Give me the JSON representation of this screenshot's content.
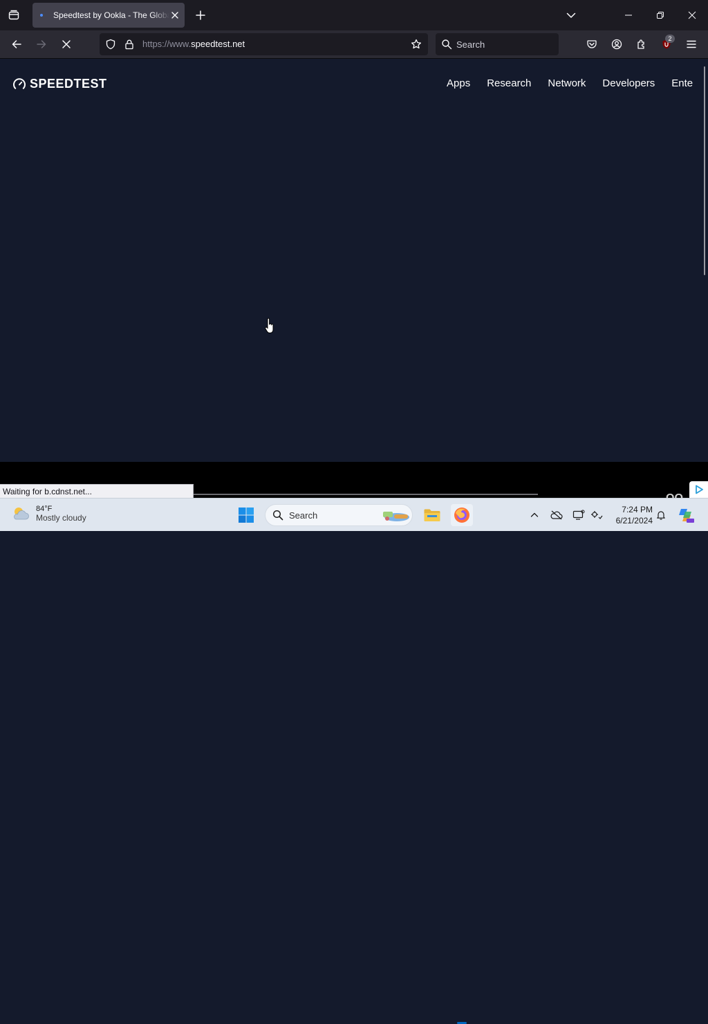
{
  "browser": {
    "active_tab_title": "Speedtest by Ookla - The Global Broadband Speed Test",
    "url_scheme": "https://www.",
    "url_host": "speedtest.net",
    "search_placeholder": "Search",
    "extension_badge_count": "2",
    "status_text": "Waiting for b.cdnst.net...",
    "loading": true
  },
  "site": {
    "logo_text": "SPEEDTEST",
    "nav_items": [
      "Apps",
      "Research",
      "Network",
      "Developers",
      "Ente"
    ],
    "footer_partial_text": "OO"
  },
  "taskbar": {
    "weather_temp": "84°F",
    "weather_desc": "Mostly cloudy",
    "search_label": "Search",
    "time": "7:24 PM",
    "date": "6/21/2024"
  },
  "colors": {
    "page_background": "#141a2c",
    "browser_chrome": "#2b2a33",
    "tab_strip": "#1c1b22",
    "taskbar": "#dfe6ef",
    "firefox_accent": "#0067c0"
  },
  "icons": {
    "tab_list": "tab-list-icon",
    "tab_close": "close-icon",
    "new_tab": "plus-icon",
    "back": "back-arrow-icon",
    "forward": "forward-arrow-icon",
    "stop": "stop-loading-icon",
    "tracking_protection": "shield-icon",
    "secure": "lock-icon",
    "bookmark": "star-icon",
    "pocket": "pocket-icon",
    "account": "account-icon",
    "extensions": "puzzle-icon",
    "ublock": "ublock-icon",
    "menu": "hamburger-menu-icon"
  }
}
